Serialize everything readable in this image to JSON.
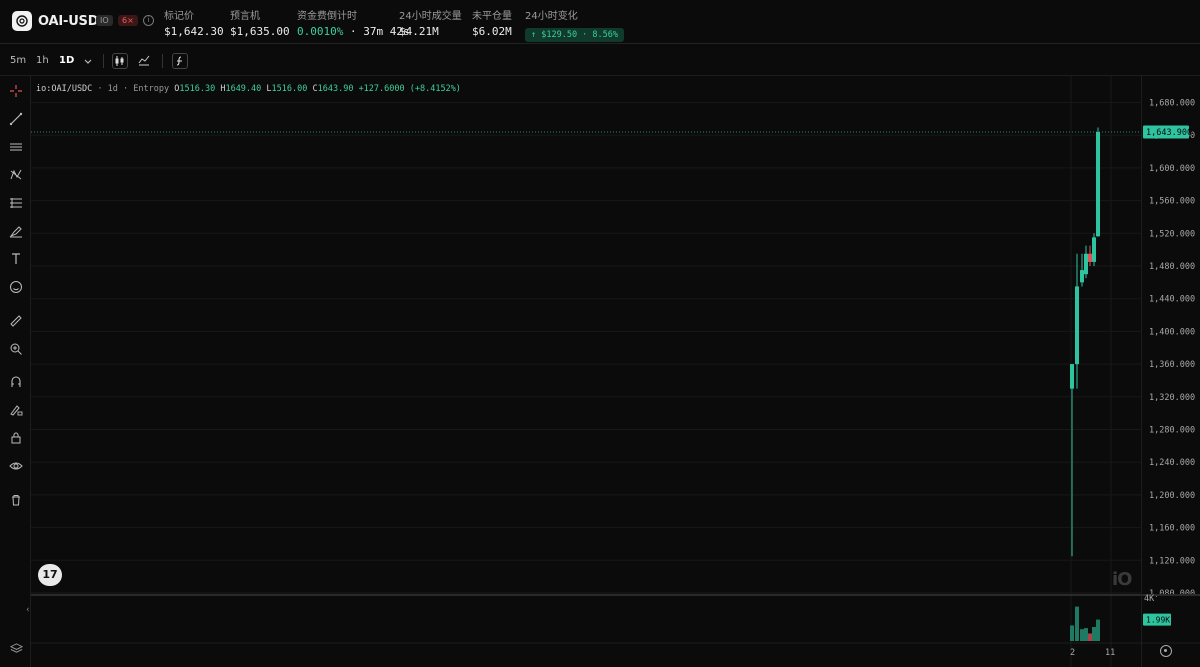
{
  "header": {
    "symbol": "OAI-USDC",
    "venue_badge": "IO",
    "leverage_badge": "6×",
    "stats": [
      {
        "label": "标记价",
        "value": "$1,642.30"
      },
      {
        "label": "预言机",
        "value": "$1,635.00"
      },
      {
        "label": "资金费倒计时",
        "funding": "0.0010%",
        "countdown": "37m 42s"
      },
      {
        "label": "24小时成交量",
        "value": "$4.21M"
      },
      {
        "label": "未平仓量",
        "value": "$6.02M"
      },
      {
        "label": "24小时变化",
        "value": "↑ $129.50 · 8.56%"
      }
    ]
  },
  "toolbar": {
    "timeframes": [
      "5m",
      "1h",
      "1D"
    ],
    "active_timeframe": "1D",
    "dropdown_icon": "chevron-down-icon",
    "icons": [
      "candles-icon",
      "line-chart-icon",
      "indicators-icon"
    ]
  },
  "left_tools": [
    "crosshair-icon",
    "trend-line-icon",
    "horizontal-lines-icon",
    "pattern-icon",
    "fib-icon",
    "brush-icon",
    "text-icon",
    "emoji-icon",
    "ruler-icon",
    "zoom-in-icon",
    "magnet-icon",
    "lock-draw-icon",
    "lock-icon",
    "eye-icon",
    "trash-icon"
  ],
  "legend": {
    "symbol": "io:OAI/USDC",
    "interval": "1d",
    "source": "Entropy",
    "o": "1516.30",
    "h": "1649.40",
    "l": "1516.00",
    "c": "1643.90",
    "change": "+127.6000",
    "change_pct": "(+8.4152%)"
  },
  "colors": {
    "up": "#2ec4a0",
    "down": "#e0525a",
    "background": "#0b0b0b"
  },
  "chart_data": {
    "type": "candlestick",
    "y_ticks": [
      "1,680.000",
      "1,640.000",
      "1,600.000",
      "1,560.000",
      "1,520.000",
      "1,480.000",
      "1,440.000",
      "1,400.000",
      "1,360.000",
      "1,320.000",
      "1,280.000",
      "1,240.000",
      "1,200.000",
      "1,160.000",
      "1,120.000",
      "1,080.000"
    ],
    "ylim": [
      1080,
      1680
    ],
    "last_price_label": "1,643.900",
    "last_price": 1643.9,
    "x_ticks": [
      "2",
      "11"
    ],
    "candles": [
      {
        "o": 1330,
        "h": 1360,
        "l": 1125,
        "c": 1360
      },
      {
        "o": 1360,
        "h": 1495,
        "l": 1330,
        "c": 1455
      },
      {
        "o": 1460,
        "h": 1495,
        "l": 1455,
        "c": 1475
      },
      {
        "o": 1470,
        "h": 1505,
        "l": 1465,
        "c": 1495
      },
      {
        "o": 1495,
        "h": 1505,
        "l": 1480,
        "c": 1485
      },
      {
        "o": 1485,
        "h": 1520,
        "l": 1480,
        "c": 1515
      },
      {
        "o": 1516.3,
        "h": 1649.4,
        "l": 1516.0,
        "c": 1643.9
      }
    ],
    "volume": {
      "label_top": "4K",
      "current_label": "1.99K",
      "values": [
        1450,
        3200,
        1100,
        1200,
        700,
        1300,
        1990
      ],
      "directions": [
        "up",
        "up",
        "up",
        "up",
        "down",
        "up",
        "up"
      ],
      "ylim": [
        0,
        4000
      ]
    }
  }
}
